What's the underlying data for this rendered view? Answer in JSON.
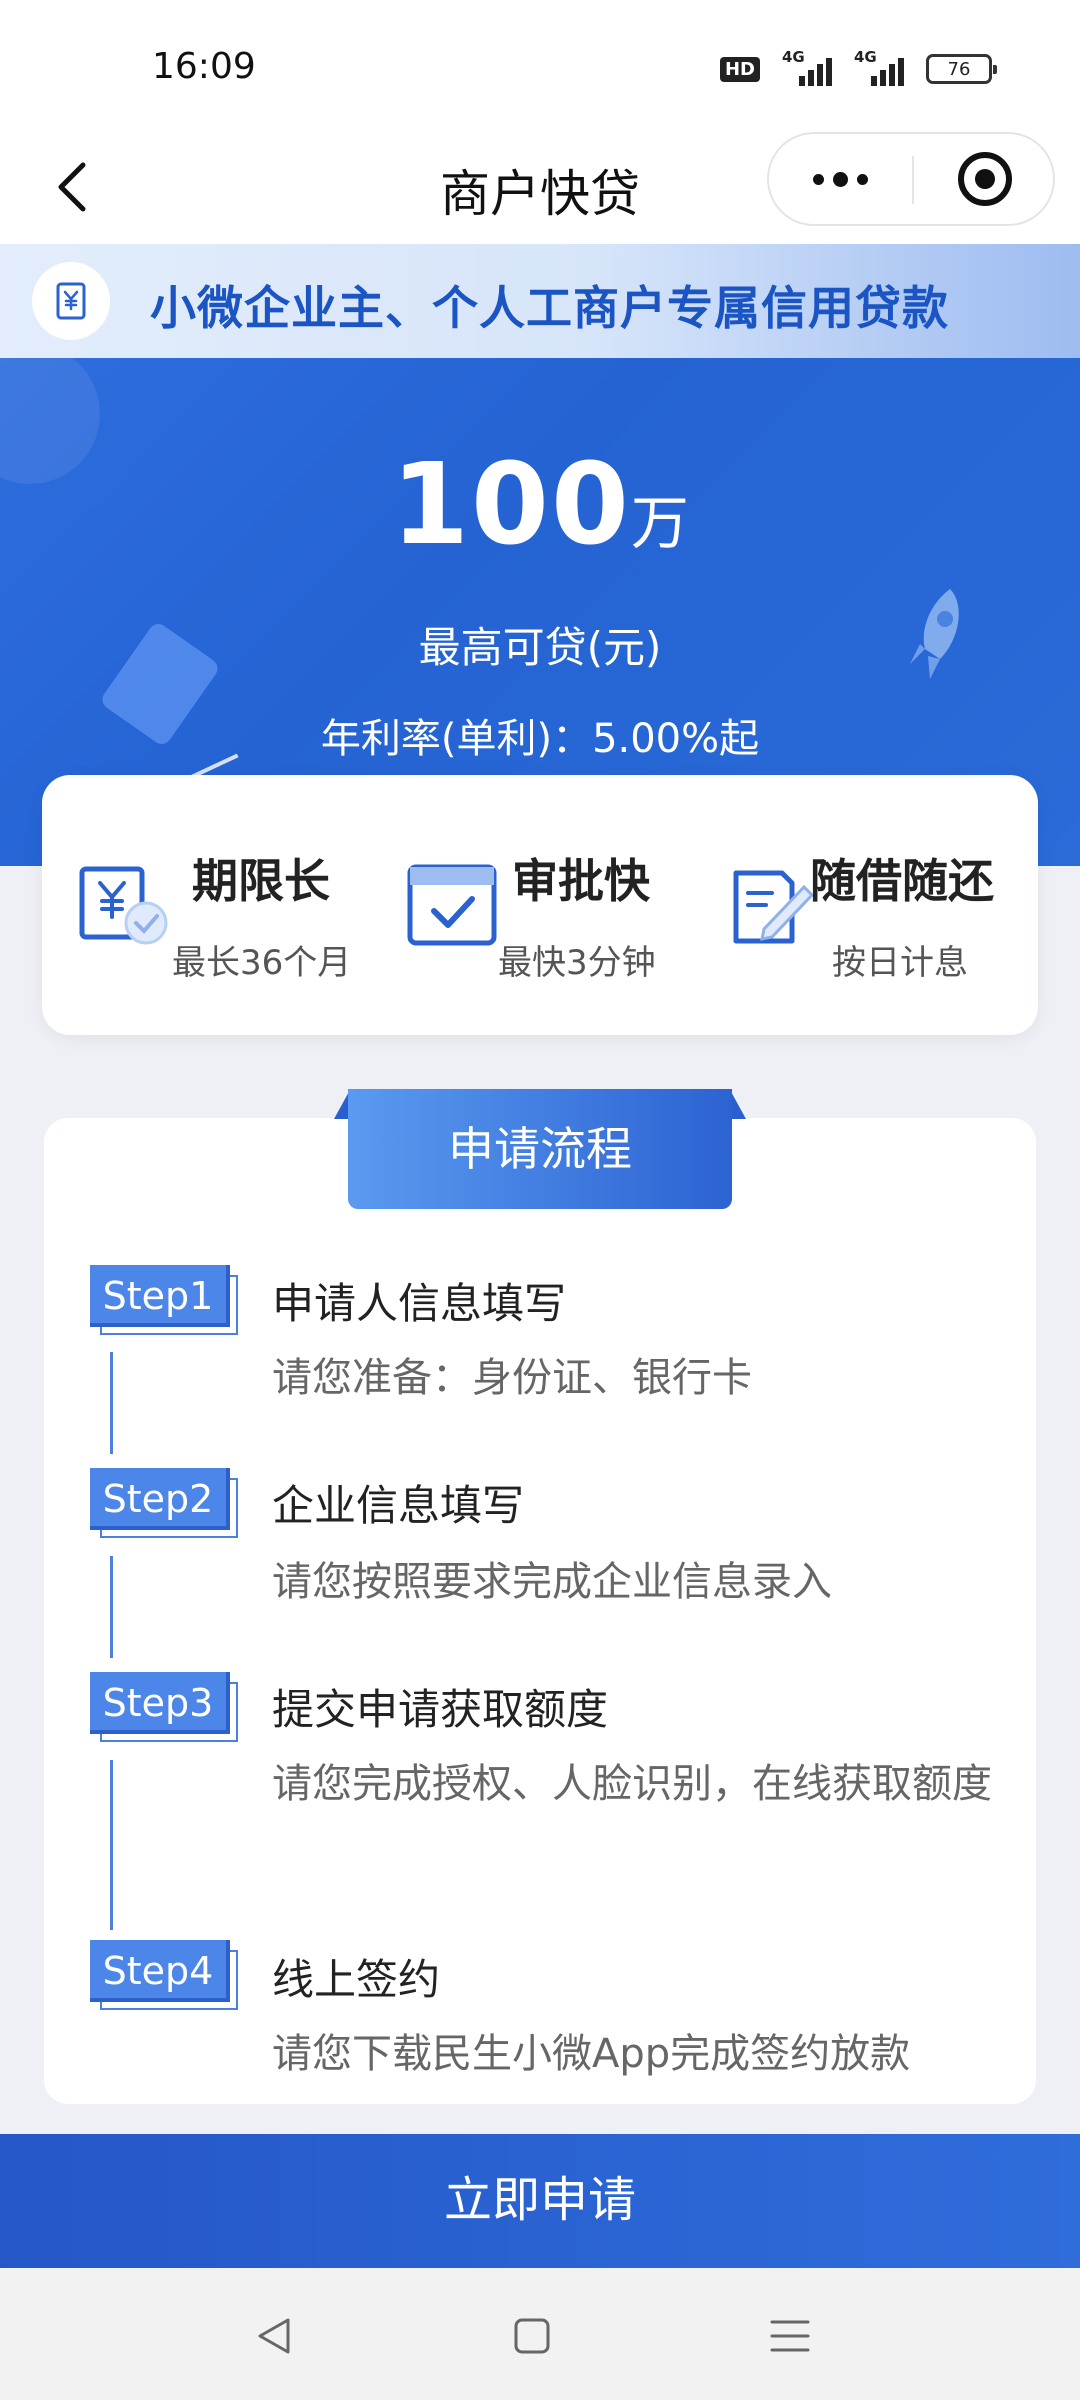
{
  "status_bar": {
    "time": "16:09",
    "hd_label": "HD",
    "network_1": "4G",
    "network_2": "4G",
    "battery": "76"
  },
  "nav": {
    "title": "商户快贷",
    "back_icon": "chevron-left-icon",
    "more_icon": "more-dots-icon",
    "close_icon": "target-circle-icon"
  },
  "banner": {
    "icon": "scroll-yuan-icon",
    "text": "小微企业主、个人工商户专属信用贷款"
  },
  "hero": {
    "amount_value": "100",
    "amount_unit": "万",
    "amount_label": "最高可贷(元)",
    "rate_text": "年利率(单利)：5.00%起"
  },
  "features": [
    {
      "icon": "yuan-document-check-icon",
      "title": "期限长",
      "subtitle": "最长36个月"
    },
    {
      "icon": "calendar-check-icon",
      "title": "审批快",
      "subtitle": "最快3分钟"
    },
    {
      "icon": "document-pen-icon",
      "title": "随借随还",
      "subtitle": "按日计息"
    }
  ],
  "process": {
    "title": "申请流程",
    "steps": [
      {
        "badge": "Step1",
        "title": "申请人信息填写",
        "desc": "请您准备：身份证、银行卡"
      },
      {
        "badge": "Step2",
        "title": "企业信息填写",
        "desc": "请您按照要求完成企业信息录入"
      },
      {
        "badge": "Step3",
        "title": "提交申请获取额度",
        "desc": "请您完成授权、人脸识别，在线获取额度"
      },
      {
        "badge": "Step4",
        "title": "线上签约",
        "desc": "请您下载民生小微App完成签约放款"
      }
    ]
  },
  "apply_button": "立即申请",
  "system_nav": {
    "back_icon": "triangle-back-icon",
    "home_icon": "square-home-icon",
    "menu_icon": "menu-lines-icon"
  },
  "colors": {
    "brand_blue": "#2563d3",
    "banner_text": "#1a55c3",
    "step_blue": "#4c86e8"
  }
}
